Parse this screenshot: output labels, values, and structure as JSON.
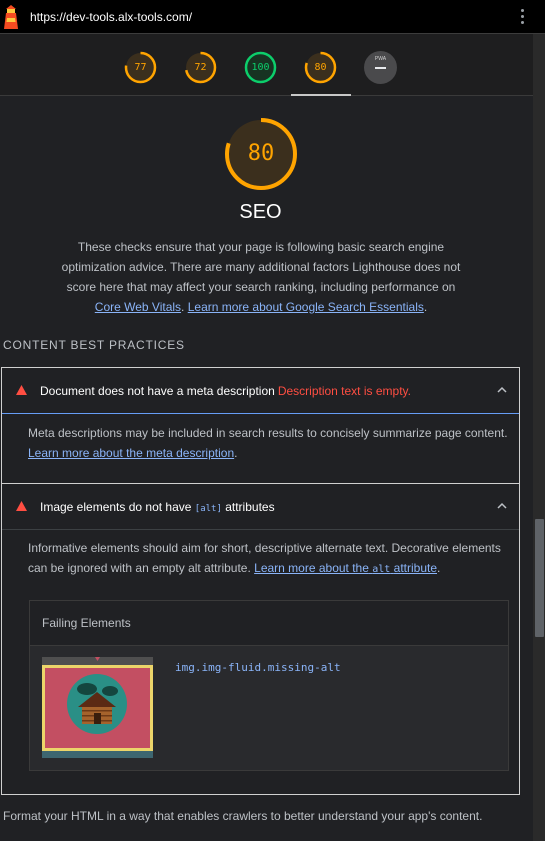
{
  "browser": {
    "url": "https://dev-tools.alx-tools.com/"
  },
  "gauges": [
    {
      "label": "77",
      "value": 77,
      "color": "#ffa400"
    },
    {
      "label": "72",
      "value": 72,
      "color": "#ffa400"
    },
    {
      "label": "100",
      "value": 100,
      "color": "#0cce6b"
    },
    {
      "label": "80",
      "value": 80,
      "color": "#ffa400"
    }
  ],
  "pwa_badge": {
    "text": "PWA"
  },
  "category": {
    "score": "80",
    "score_value": 80,
    "title": "SEO",
    "description": "These checks ensure that your page is following basic search engine optimization advice. There are many additional factors Lighthouse does not score here that may affect your search ranking, including performance on",
    "link1": "Core Web Vitals",
    "sep": ". ",
    "link2": "Learn more about Google Search Essentials",
    "end": "."
  },
  "group": {
    "title": "CONTENT BEST PRACTICES"
  },
  "audits": [
    {
      "title": "Document does not have a meta description",
      "fail_text": "Description text is empty.",
      "body": "Meta descriptions may be included in search results to concisely summarize page content.",
      "link": "Learn more about the meta description",
      "link_end": "."
    },
    {
      "title_pre": "Image elements do not have",
      "title_code": "[alt]",
      "title_post": "attributes",
      "body": "Informative elements should aim for short, descriptive alternate text. Decorative elements can be ignored with an empty alt attribute.",
      "link_pre": "Learn more about the",
      "link_code": "alt",
      "link_post": "attribute",
      "link_end": ".",
      "table_header": "Failing Elements",
      "selector": "img.img-fluid.missing-alt"
    }
  ],
  "footnote": "Format your HTML in a way that enables crawlers to better understand your app's content.",
  "colors": {
    "orange": "#ffa400",
    "green": "#0cce6b",
    "red": "#ff4e42",
    "link": "#8ab4f8"
  }
}
